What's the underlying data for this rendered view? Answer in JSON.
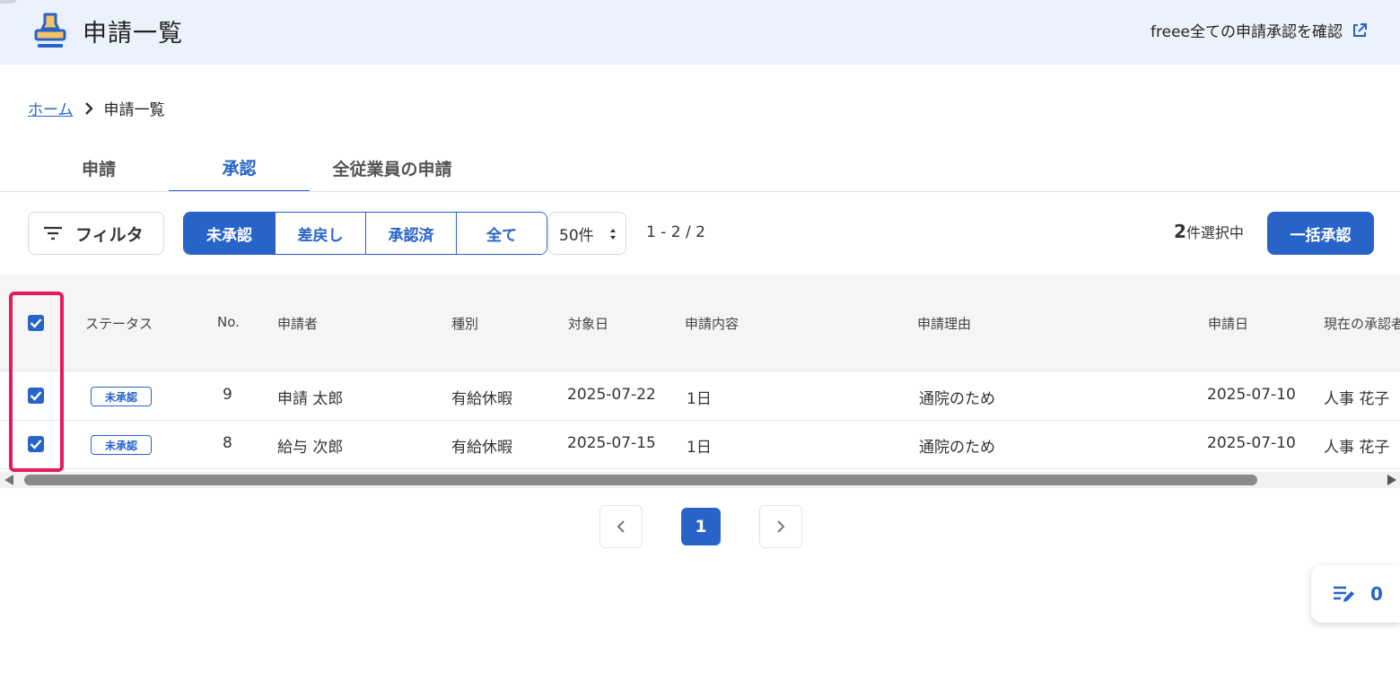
{
  "header": {
    "title": "申請一覧",
    "link_label": "freee全ての申請承認を確認",
    "logo_icon": "stamp-icon",
    "link_icon": "external-link-icon"
  },
  "breadcrumb": {
    "home": "ホーム",
    "current": "申請一覧"
  },
  "tabs": [
    {
      "label": "申請",
      "active": false
    },
    {
      "label": "承認",
      "active": true
    },
    {
      "label": "全従業員の申請",
      "active": false
    }
  ],
  "toolbar": {
    "filter_label": "フィルタ",
    "segments": [
      "未承認",
      "差戻し",
      "承認済",
      "全て"
    ],
    "active_segment": "未承認",
    "per_page": "50件",
    "range": "1 - 2 / 2",
    "selected_count": "2",
    "selected_suffix": "件選択中",
    "bulk_approve_label": "一括承認"
  },
  "table": {
    "columns": [
      "ステータス",
      "No.",
      "申請者",
      "種別",
      "対象日",
      "申請内容",
      "申請理由",
      "申請日",
      "現在の承認者"
    ],
    "rows": [
      {
        "checked": true,
        "status": "未承認",
        "no": "9",
        "applicant": "申請 太郎",
        "type": "有給休暇",
        "target_date": "2025-07-22",
        "content": "1日",
        "reason": "通院のため",
        "applied_date": "2025-07-10",
        "approver": "人事 花子"
      },
      {
        "checked": true,
        "status": "未承認",
        "no": "8",
        "applicant": "給与 次郎",
        "type": "有給休暇",
        "target_date": "2025-07-15",
        "content": "1日",
        "reason": "通院のため",
        "applied_date": "2025-07-10",
        "approver": "人事 花子"
      }
    ]
  },
  "pagination": {
    "current_page": "1"
  },
  "floating_widget": {
    "icon": "edit-list-icon",
    "count": "0"
  },
  "colors": {
    "primary": "#2864c8",
    "header_bg": "#ebf2fc",
    "highlight": "#e6195a"
  }
}
